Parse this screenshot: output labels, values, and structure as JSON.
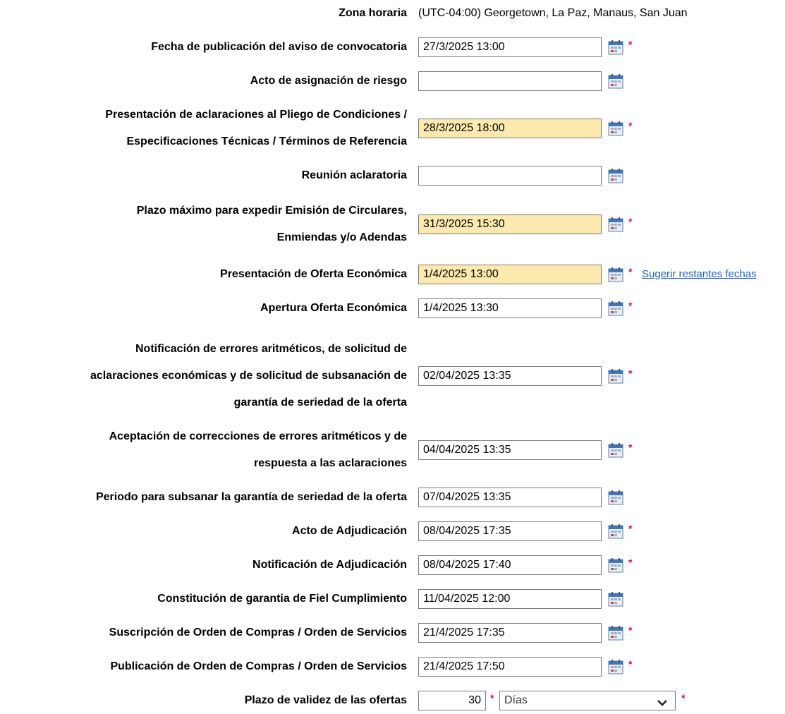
{
  "timezone": {
    "label": "Zona horaria",
    "value": "(UTC-04:00) Georgetown, La Paz, Manaus, San Juan"
  },
  "rows": [
    {
      "label_lines": [
        "Fecha de publicación del aviso de convocatoria"
      ],
      "value": "27/3/2025 13:00",
      "highlighted": false,
      "required": true
    },
    {
      "label_lines": [
        "Acto de asignación de riesgo"
      ],
      "value": "",
      "highlighted": false,
      "required": false
    },
    {
      "label_lines": [
        "Presentación de aclaraciones al Pliego de Condiciones /",
        "Especificaciones Técnicas / Términos de Referencia"
      ],
      "value": "28/3/2025 18:00",
      "highlighted": true,
      "required": true
    },
    {
      "label_lines": [
        "Reunión aclaratoria"
      ],
      "value": "",
      "highlighted": false,
      "required": false
    },
    {
      "label_lines": [
        "Plazo máximo para expedir Emisión de Circulares,",
        "Enmiendas y/o Adendas"
      ],
      "value": "31/3/2025 15:30",
      "highlighted": true,
      "required": true
    },
    {
      "label_lines": [
        "Presentación de Oferta Económica"
      ],
      "value": "1/4/2025 13:00",
      "highlighted": true,
      "required": true,
      "link": "Sugerir restantes fechas"
    },
    {
      "label_lines": [
        "Apertura Oferta Económica"
      ],
      "value": "1/4/2025 13:30",
      "highlighted": false,
      "required": true
    },
    {
      "label_lines": [
        "Notificación de errores aritméticos, de solicitud de",
        "aclaraciones económicas y de solicitud de subsanación de",
        "garantía de seriedad de la oferta"
      ],
      "value": "02/04/2025 13:35",
      "highlighted": false,
      "required": true
    },
    {
      "label_lines": [
        "Aceptación de correcciones de errores aritméticos y de",
        "respuesta a las aclaraciones"
      ],
      "value": "04/04/2025 13:35",
      "highlighted": false,
      "required": true
    },
    {
      "label_lines": [
        "Periodo para subsanar la garantía de seriedad de la oferta"
      ],
      "value": "07/04/2025 13:35",
      "highlighted": false,
      "required": false
    },
    {
      "label_lines": [
        "Acto de Adjudicación"
      ],
      "value": "08/04/2025 17:35",
      "highlighted": false,
      "required": true
    },
    {
      "label_lines": [
        "Notificación de Adjudicación"
      ],
      "value": "08/04/2025 17:40",
      "highlighted": false,
      "required": true
    },
    {
      "label_lines": [
        "Constitución de garantia de Fiel Cumplimiento"
      ],
      "value": "11/04/2025 12:00",
      "highlighted": false,
      "required": false
    },
    {
      "label_lines": [
        "Suscripción de Orden de Compras / Orden de Servicios"
      ],
      "value": "21/4/2025 17:35",
      "highlighted": false,
      "required": true
    },
    {
      "label_lines": [
        "Publicación de Orden de Compras / Orden de Servicios"
      ],
      "value": "21/4/2025 17:50",
      "highlighted": false,
      "required": true
    }
  ],
  "validity": {
    "label": "Plazo de validez de las ofertas",
    "number": "30",
    "unit": "Días"
  },
  "required_marker": "*",
  "colors": {
    "highlight": "#fbe9ae",
    "required": "#d8133a",
    "link": "#1a5fd0"
  },
  "icons": {
    "calendar": "calendar-icon",
    "dropdown": "chevron-down-icon"
  }
}
